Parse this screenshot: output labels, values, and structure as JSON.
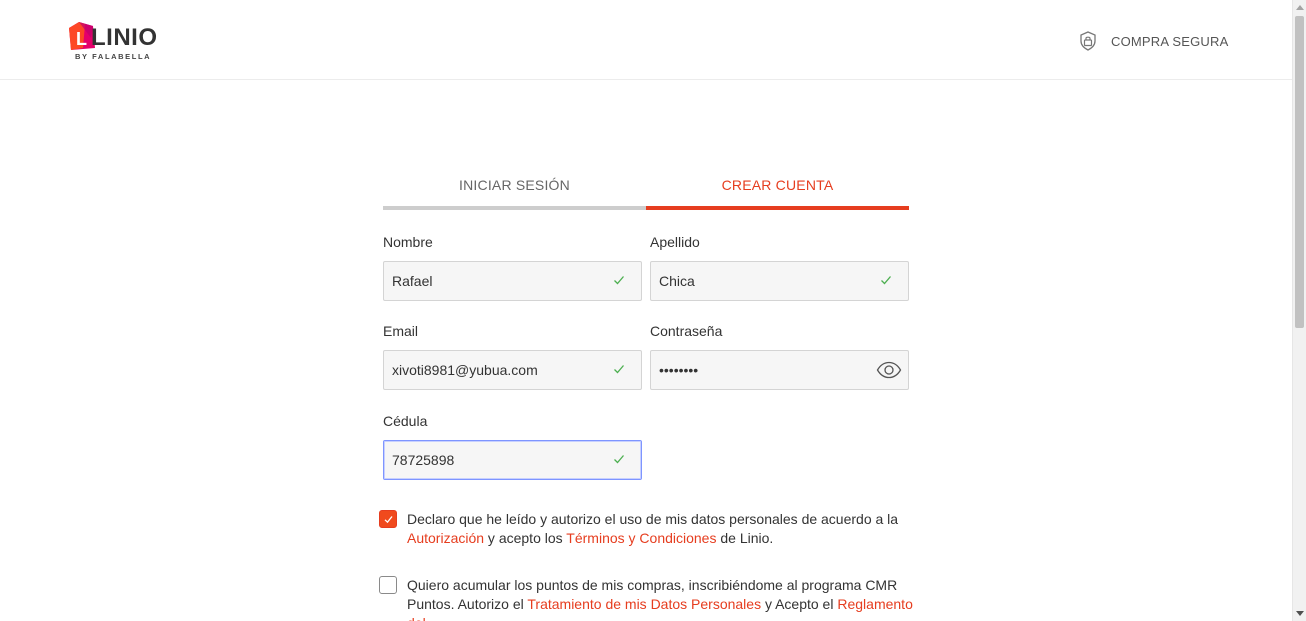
{
  "header": {
    "brand": "LINIO",
    "brand_sub": "BY FALABELLA",
    "secure_label": "COMPRA SEGURA"
  },
  "colors": {
    "accent": "#e63d1f",
    "check_green": "#4caf50",
    "tab_inactive_bar": "#cdcdcd"
  },
  "tabs": [
    {
      "label": "INICIAR SESIÓN",
      "active": false
    },
    {
      "label": "CREAR CUENTA",
      "active": true
    }
  ],
  "form": {
    "nombre": {
      "label": "Nombre",
      "value": "Rafael"
    },
    "apellido": {
      "label": "Apellido",
      "value": "Chica"
    },
    "email": {
      "label": "Email",
      "value": "xivoti8981@yubua.com"
    },
    "password": {
      "label": "Contraseña",
      "value": "••••••••"
    },
    "cedula": {
      "label": "Cédula",
      "value": "78725898"
    }
  },
  "consent1": {
    "checked": true,
    "text_a": "Declaro que he leído y autorizo el uso de mis datos personales de acuerdo a la ",
    "link1": "Autorización",
    "text_b": " y acepto los ",
    "link2": "Términos y Condiciones",
    "text_c": " de Linio."
  },
  "consent2": {
    "checked": false,
    "text_a": "Quiero acumular los puntos de mis compras, inscribiéndome al programa CMR Puntos. Autorizo el ",
    "link1": "Tratamiento de mis Datos Personales",
    "text_b": " y Acepto el ",
    "link2": "Reglamento del..."
  },
  "icons": {
    "logo": "linio-tag-logo",
    "secure": "lock-shield-icon",
    "valid": "check-icon",
    "reveal": "eye-icon",
    "checkbox_checked": "checkmark-icon"
  }
}
